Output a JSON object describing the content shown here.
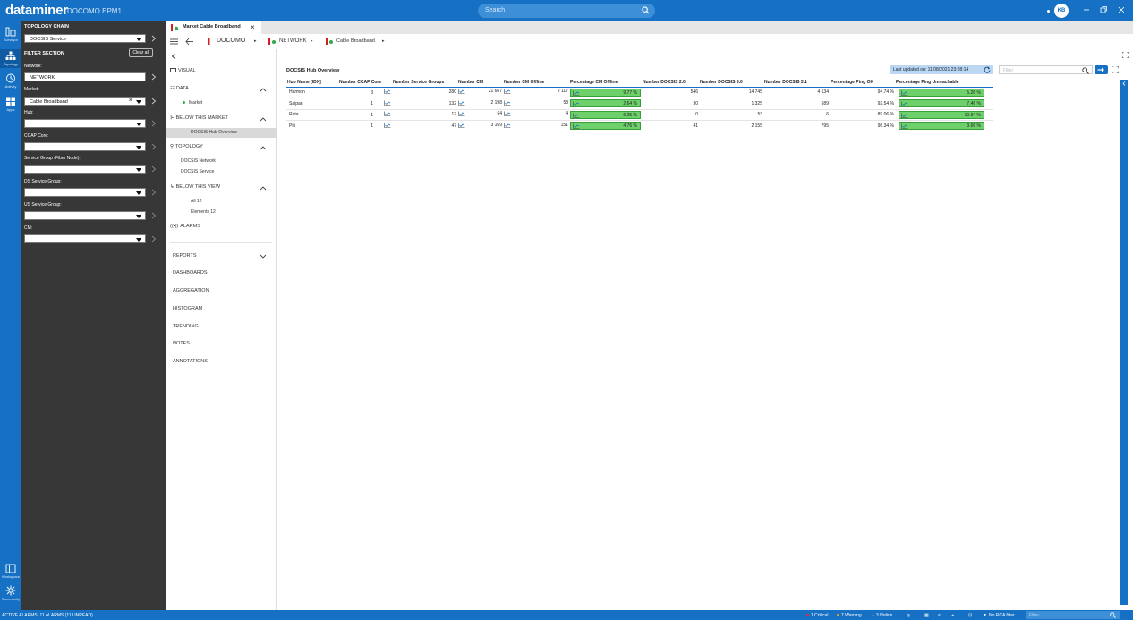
{
  "titlebar": {
    "logo": "dataminer",
    "app_name": "DOCOMO EPM1",
    "search_placeholder": "Search",
    "user_initials": "KB"
  },
  "rail": {
    "items": [
      {
        "label": "Surveyor",
        "icon": "surveyor-icon"
      },
      {
        "label": "Topology",
        "icon": "topology-icon"
      },
      {
        "label": "Activity",
        "icon": "activity-icon"
      },
      {
        "label": "Apps",
        "icon": "apps-icon"
      },
      {
        "label": "Workspace",
        "icon": "workspace-icon"
      },
      {
        "label": "Community",
        "icon": "community-icon"
      }
    ]
  },
  "topology": {
    "chain_title": "TOPOLOGY CHAIN",
    "chain_value": "DOCSIS Service",
    "filter_title": "FILTER SECTION",
    "clear_all": "Clear all",
    "filters": [
      {
        "label": "Network:",
        "value": "NETWORK"
      },
      {
        "label": "Market:",
        "value": "Cable Broadband"
      },
      {
        "label": "Hub:",
        "value": ""
      },
      {
        "label": "CCAP Core:",
        "value": ""
      },
      {
        "label": "Service Group (Fiber Node):",
        "value": ""
      },
      {
        "label": "DS Service Group:",
        "value": ""
      },
      {
        "label": "US Service Group:",
        "value": ""
      },
      {
        "label": "CM:",
        "value": ""
      }
    ]
  },
  "tab": {
    "label": "Market Cable Broadband"
  },
  "breadcrumb": [
    "DOCOMO",
    "NETWORK",
    "Cable Broadband"
  ],
  "nav": {
    "visual": "VISUAL",
    "data": "DATA",
    "market": "Market",
    "below_market": "BELOW THIS MARKET",
    "hub_overview": "DOCSIS Hub Overview",
    "topology": "TOPOLOGY",
    "docsis_network": "DOCSIS Network",
    "docsis_service": "DOCSIS Service",
    "below_view": "BELOW THIS VIEW",
    "all": "All 12",
    "elements": "Elements 12",
    "alarms": "ALARMS",
    "reports": "REPORTS",
    "dashboards": "DASHBOARDS",
    "aggregation": "AGGREGATION",
    "histogram": "HISTOGRAM",
    "trending": "TRENDING",
    "notes": "NOTES",
    "annotations": "ANNOTATIONS"
  },
  "content": {
    "title": "DOCSIS Hub Overview",
    "last_updated": "Last updated on: 11/08/2021 23:28:14",
    "filter_placeholder": "Filter",
    "columns": [
      "Hub Name [IDX]",
      "Number CCAP Core",
      "Number Service Groups",
      "Number CM",
      "Number CM Offline",
      "Percentage CM Offline",
      "Number DOCSIS 2.0",
      "Number DOCSIS 3.0",
      "Number DOCSIS 3.1",
      "Percentage Ping OK",
      "Percentage Ping Unreachable"
    ],
    "rows": [
      {
        "hub": "Harmon",
        "ccap": "3",
        "sg": "280",
        "cm": "21 667",
        "offline": "2 117",
        "pct_offline": "9.77 %",
        "d20": "546",
        "d30": "14 745",
        "d31": "4 134",
        "ping_ok": "94.74 %",
        "ping_unreach": "5.26 %"
      },
      {
        "hub": "Saipan",
        "ccap": "1",
        "sg": "132",
        "cm": "2 198",
        "offline": "58",
        "pct_offline": "2.64 %",
        "d20": "30",
        "d30": "1 325",
        "d31": "689",
        "ping_ok": "92.54 %",
        "ping_unreach": "7.46 %"
      },
      {
        "hub": "Rota",
        "ccap": "1",
        "sg": "12",
        "cm": "64",
        "offline": "4",
        "pct_offline": "6.25 %",
        "d20": "0",
        "d30": "53",
        "d31": "6",
        "ping_ok": "89.06 %",
        "ping_unreach": "10.94 %"
      },
      {
        "hub": "Piti",
        "ccap": "1",
        "sg": "47",
        "cm": "3 169",
        "offline": "151",
        "pct_offline": "4.76 %",
        "d20": "41",
        "d30": "2 155",
        "d31": "795",
        "ping_ok": "96.34 %",
        "ping_unreach": "3.66 %"
      }
    ]
  },
  "statusbar": {
    "alarms": "ACTIVE ALARMS: 11 ALARMS (11 UNREAD)",
    "critical": "1 Critical",
    "warning": "7 Warning",
    "notice": "3 Notice",
    "rca": "No RCA filter",
    "filter_placeholder": "Filter"
  },
  "colors": {
    "brand": "#1671c4",
    "panel_dark": "#373737",
    "bar_green": "#6ed06a",
    "critical": "#e03030",
    "warning": "#f0a020",
    "notice": "#f5d000"
  }
}
